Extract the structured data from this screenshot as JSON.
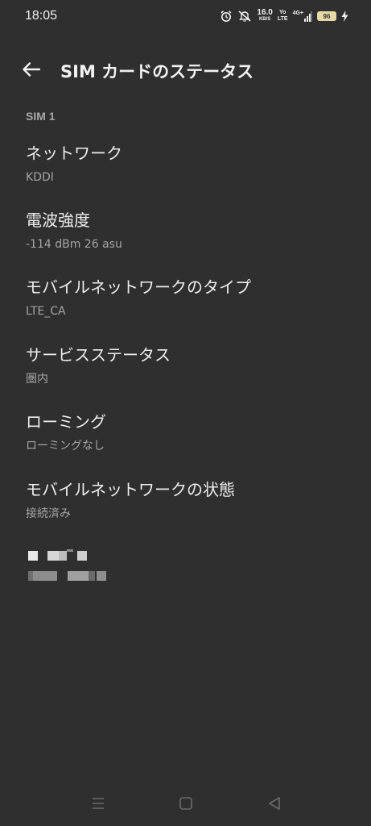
{
  "status_bar": {
    "time": "18:05",
    "net_speed_value": "16.0",
    "net_speed_unit": "KB/S",
    "volte_top": "Yo",
    "volte_bottom": "LTE",
    "network_type": "4G+",
    "battery_level": "96",
    "icons": [
      "alarm-icon",
      "vibrate-mute-icon",
      "signal-icon",
      "battery-icon",
      "charging-icon"
    ]
  },
  "app_bar": {
    "back_icon": "arrow-left-icon",
    "title": "SIM カードのステータス"
  },
  "section": {
    "header": "SIM 1"
  },
  "items": [
    {
      "title": "ネットワーク",
      "value": "KDDI"
    },
    {
      "title": "電波強度",
      "value": "-114 dBm 26 asu"
    },
    {
      "title": "モバイルネットワークのタイプ",
      "value": "LTE_CA"
    },
    {
      "title": "サービスステータス",
      "value": "圏内"
    },
    {
      "title": "ローミング",
      "value": "ローミングなし"
    },
    {
      "title": "モバイルネットワークの状態",
      "value": "接続済み"
    }
  ],
  "nav_bar": {
    "icons": [
      "menu-icon",
      "home-icon",
      "back-triangle-icon"
    ]
  },
  "colors": {
    "background": "#2f2f2f",
    "title_text": "#ededed",
    "secondary_text": "#a5a5a5",
    "battery": "#e6d9a6"
  }
}
